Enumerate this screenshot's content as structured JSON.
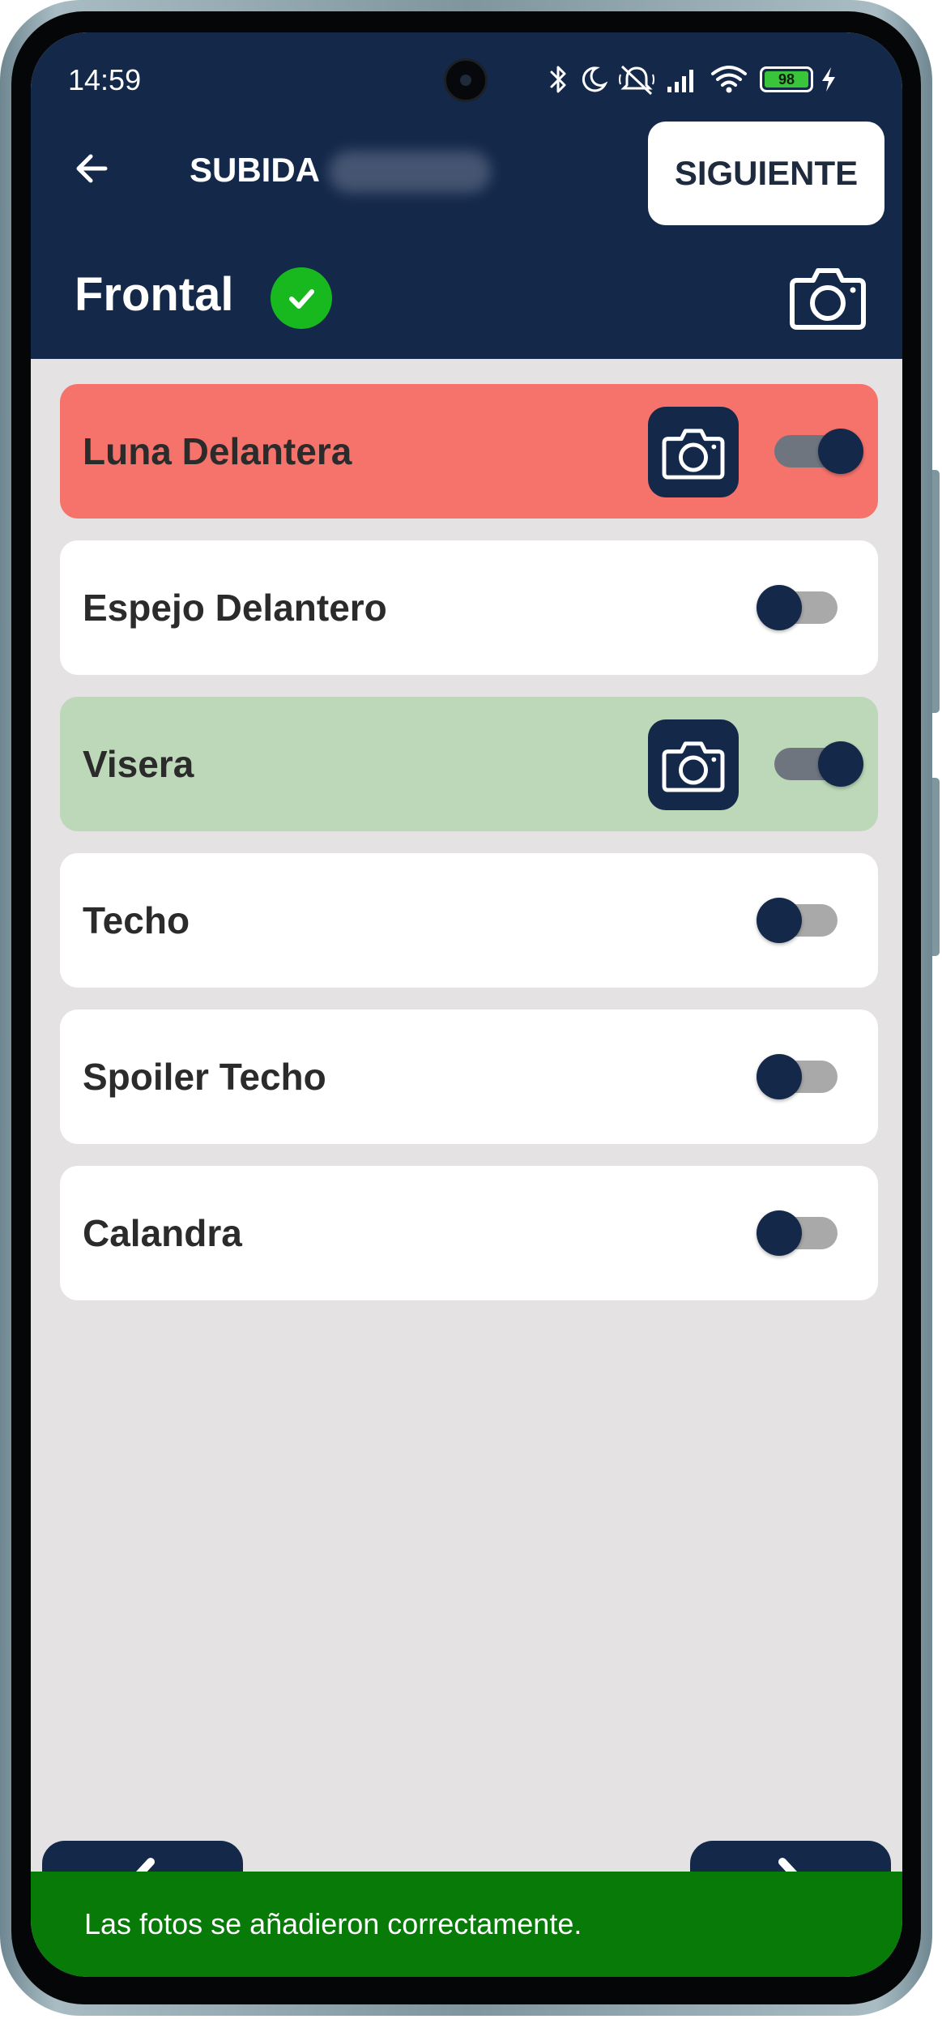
{
  "status_bar": {
    "time": "14:59",
    "battery_level": "98",
    "icons": [
      "bluetooth-icon",
      "moon-icon",
      "mute-icon",
      "signal-icon",
      "wifi-icon",
      "battery-icon",
      "charging-icon"
    ]
  },
  "header": {
    "back_icon": "arrow-left-icon",
    "title": "SUBIDA",
    "next_label": "SIGUIENTE",
    "color": "#14284a"
  },
  "section": {
    "title": "Frontal",
    "check_icon": "check-circle-icon",
    "camera_icon": "camera-icon"
  },
  "items": [
    {
      "label": "Luna Delantera",
      "enabled": true,
      "status": "error",
      "has_photo_button": true,
      "color": "#f6736b"
    },
    {
      "label": "Espejo Delantero",
      "enabled": false,
      "status": "none",
      "has_photo_button": false,
      "color": "#ffffff"
    },
    {
      "label": "Visera",
      "enabled": true,
      "status": "ok",
      "has_photo_button": true,
      "color": "#bcd8b8"
    },
    {
      "label": "Techo",
      "enabled": false,
      "status": "none",
      "has_photo_button": false,
      "color": "#ffffff"
    },
    {
      "label": "Spoiler Techo",
      "enabled": false,
      "status": "none",
      "has_photo_button": false,
      "color": "#ffffff"
    },
    {
      "label": "Calandra",
      "enabled": false,
      "status": "none",
      "has_photo_button": false,
      "color": "#ffffff"
    }
  ],
  "navigation": {
    "prev_icon": "chevron-left-icon",
    "next_icon": "chevron-right-icon"
  },
  "toast": {
    "message": "Las fotos se añadieron correctamente.",
    "color": "#077a08"
  }
}
